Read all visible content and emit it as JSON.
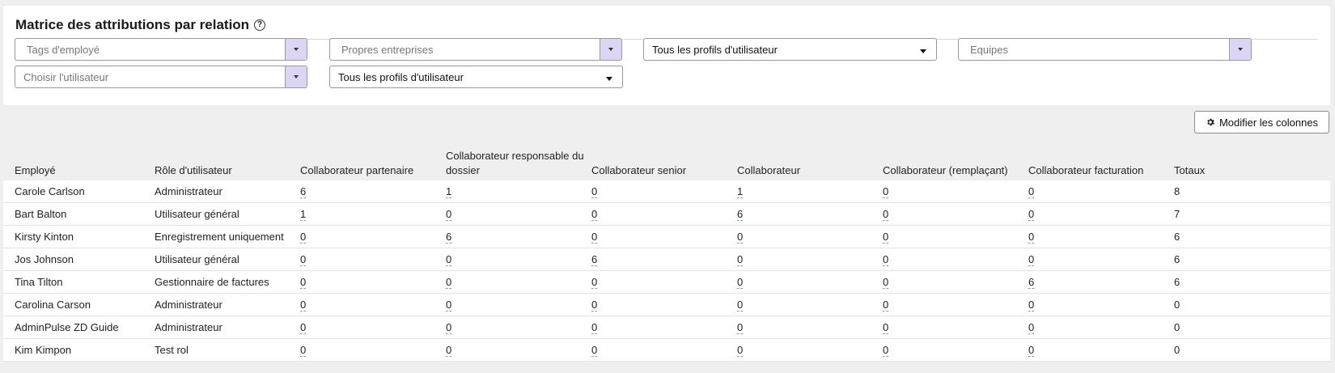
{
  "panel": {
    "title": "Matrice des attributions par relation",
    "help_icon": "question-circle-icon"
  },
  "filters": {
    "employee_tags": {
      "placeholder": "Tags d'employé"
    },
    "own_companies": {
      "placeholder": "Propres entreprises"
    },
    "user_profiles_1": {
      "value": "Tous les profils d'utilisateur"
    },
    "teams": {
      "placeholder": "Equipes"
    },
    "choose_user": {
      "placeholder": "Choisir l'utilisateur"
    },
    "user_profiles_2": {
      "value": "Tous les profils d'utilisateur"
    }
  },
  "modify_columns": {
    "label": "Modifier les colonnes",
    "icon": "gear-icon"
  },
  "table": {
    "columns": [
      "Employé",
      "Rôle d'utilisateur",
      "Collaborateur partenaire",
      "Collaborateur responsable du dossier",
      "Collaborateur senior",
      "Collaborateur",
      "Collaborateur (remplaçant)",
      "Collaborateur facturation",
      "Totaux"
    ],
    "rows": [
      [
        "Carole Carlson",
        "Administrateur",
        "6",
        "1",
        "0",
        "1",
        "0",
        "0",
        "8"
      ],
      [
        "Bart Balton",
        "Utilisateur général",
        "1",
        "0",
        "0",
        "6",
        "0",
        "0",
        "7"
      ],
      [
        "Kirsty Kinton",
        "Enregistrement uniquement",
        "0",
        "6",
        "0",
        "0",
        "0",
        "0",
        "6"
      ],
      [
        "Jos Johnson",
        "Utilisateur général",
        "0",
        "0",
        "6",
        "0",
        "0",
        "0",
        "6"
      ],
      [
        "Tina Tilton",
        "Gestionnaire de factures",
        "0",
        "0",
        "0",
        "0",
        "0",
        "6",
        "6"
      ],
      [
        "Carolina Carson",
        "Administrateur",
        "0",
        "0",
        "0",
        "0",
        "0",
        "0",
        "0"
      ],
      [
        "AdminPulse ZD Guide",
        "Administrateur",
        "0",
        "0",
        "0",
        "0",
        "0",
        "0",
        "0"
      ],
      [
        "Kim Kimpon",
        "Test rol",
        "0",
        "0",
        "0",
        "0",
        "0",
        "0",
        "0"
      ]
    ]
  }
}
